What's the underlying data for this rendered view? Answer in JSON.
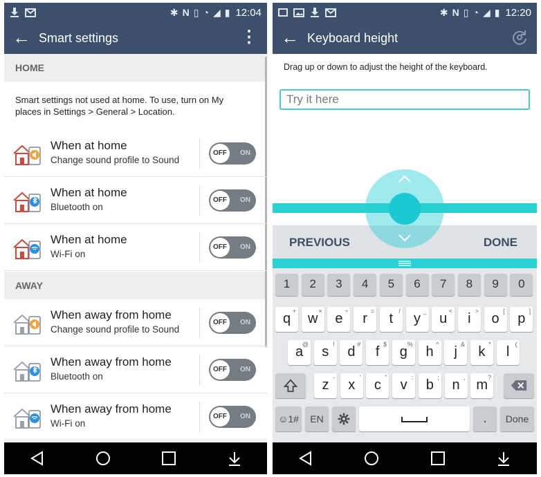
{
  "left": {
    "status": {
      "time": "12:04"
    },
    "appbar": {
      "title": "Smart settings"
    },
    "home_section": {
      "label": "HOME"
    },
    "note": "Smart settings not used at home. To use, turn on My places in Settings > General > Location.",
    "away_section": {
      "label": "AWAY"
    },
    "rows": [
      {
        "title": "When at home",
        "subtitle": "Change sound profile to Sound",
        "off": "OFF",
        "on": "ON",
        "icon": "home-sound-icon"
      },
      {
        "title": "When at home",
        "subtitle": "Bluetooth on",
        "off": "OFF",
        "on": "ON",
        "icon": "home-bluetooth-icon"
      },
      {
        "title": "When at home",
        "subtitle": "Wi-Fi on",
        "off": "OFF",
        "on": "ON",
        "icon": "home-wifi-icon"
      },
      {
        "title": "When away from home",
        "subtitle": "Change sound profile to Sound",
        "off": "OFF",
        "on": "ON",
        "icon": "away-sound-icon"
      },
      {
        "title": "When away from home",
        "subtitle": "Bluetooth on",
        "off": "OFF",
        "on": "ON",
        "icon": "away-bluetooth-icon"
      },
      {
        "title": "When away from home",
        "subtitle": "Wi-Fi on",
        "off": "OFF",
        "on": "ON",
        "icon": "away-wifi-icon"
      }
    ]
  },
  "right": {
    "status": {
      "time": "12:20"
    },
    "appbar": {
      "title": "Keyboard height"
    },
    "instruction": "Drag up or down to adjust the height of the keyboard.",
    "input": {
      "placeholder": "Try it here",
      "value": ""
    },
    "keyboard_bar": {
      "previous": "PREVIOUS",
      "done": "DONE"
    },
    "keys": {
      "numbers": [
        "1",
        "2",
        "3",
        "4",
        "5",
        "6",
        "7",
        "8",
        "9",
        "0"
      ],
      "row1": [
        {
          "k": "q",
          "h": "+"
        },
        {
          "k": "w",
          "h": "×"
        },
        {
          "k": "e",
          "h": "÷"
        },
        {
          "k": "r",
          "h": "="
        },
        {
          "k": "t",
          "h": "/"
        },
        {
          "k": "y",
          "h": "_"
        },
        {
          "k": "u",
          "h": "<"
        },
        {
          "k": "i",
          "h": ">"
        },
        {
          "k": "o",
          "h": "["
        },
        {
          "k": "p",
          "h": "]"
        }
      ],
      "row2": [
        {
          "k": "a",
          "h": "@"
        },
        {
          "k": "s",
          "h": "!"
        },
        {
          "k": "d",
          "h": "#"
        },
        {
          "k": "f",
          "h": "$"
        },
        {
          "k": "g",
          "h": "%"
        },
        {
          "k": "h",
          "h": "^"
        },
        {
          "k": "j",
          "h": "&"
        },
        {
          "k": "k",
          "h": "*"
        },
        {
          "k": "l",
          "h": "("
        }
      ],
      "row3": [
        {
          "k": "z",
          "h": "-"
        },
        {
          "k": "x",
          "h": "'"
        },
        {
          "k": "c",
          "h": "\""
        },
        {
          "k": "v",
          "h": ":"
        },
        {
          "k": "b",
          "h": ";"
        },
        {
          "k": "n",
          "h": ","
        },
        {
          "k": "m",
          "h": "?"
        }
      ],
      "symbols_label": "☺1#",
      "language_label": "EN",
      "period_label": ".",
      "done_label": "Done"
    }
  }
}
